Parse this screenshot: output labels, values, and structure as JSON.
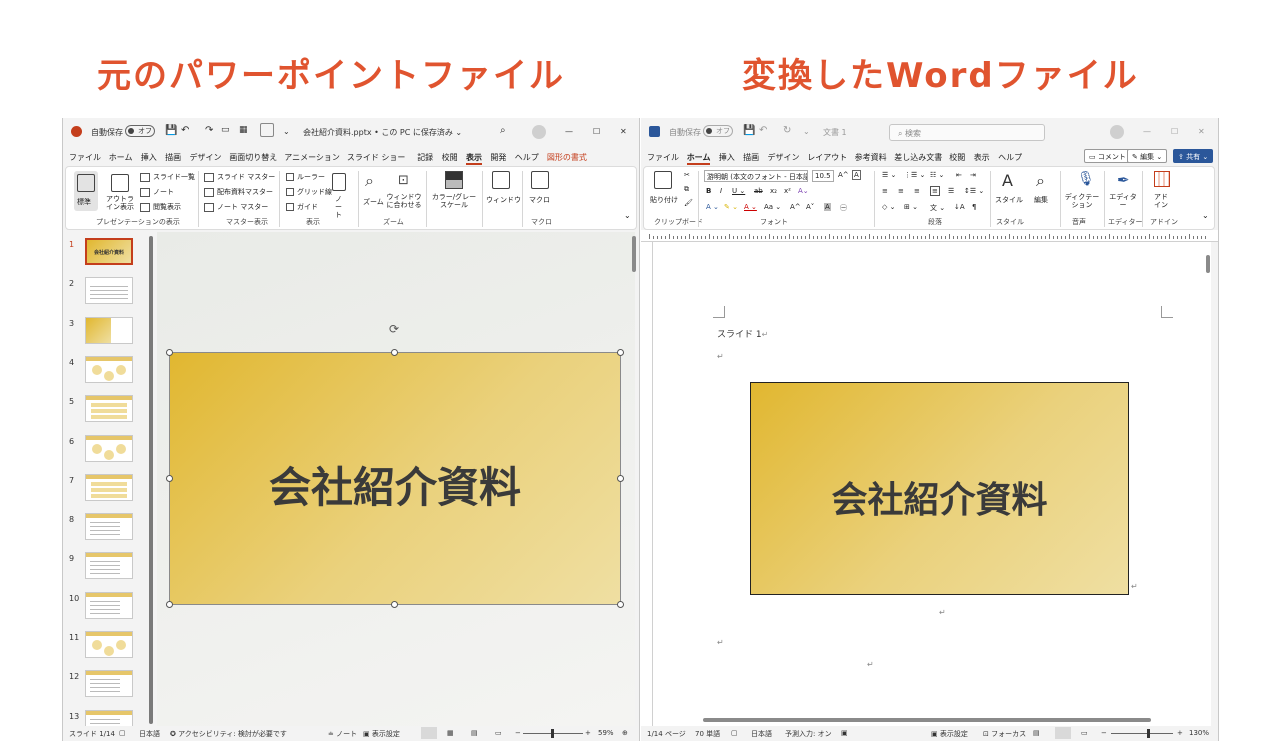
{
  "headings": {
    "left": "元のパワーポイントファイル",
    "right": "変換したWordファイル"
  },
  "colors": {
    "heading": "#e0542f",
    "ppt_accent": "#c43e1c",
    "word_accent": "#2b579a",
    "slide_gold": "#e1b730"
  },
  "ppt": {
    "autosave_label": "自動保存",
    "autosave_state": "オフ",
    "window_title": "会社紹介資料.pptx • この PC に保存済み ⌄",
    "menu": [
      "ファイル",
      "ホーム",
      "挿入",
      "描画",
      "デザイン",
      "画面切り替え",
      "アニメーション",
      "スライド ショー",
      "記録",
      "校閲",
      "表示",
      "開発",
      "ヘルプ",
      "図形の書式"
    ],
    "active_menu": "表示",
    "ribbon": {
      "normal": "標準",
      "outline": "アウトライン表示",
      "slide_sorter": "スライド一覧",
      "notes_page": "ノート",
      "reading": "閲覧表示",
      "group_presentation": "プレゼンテーションの表示",
      "slide_master": "スライド マスター",
      "handout_master": "配布資料マスター",
      "notes_master": "ノート マスター",
      "group_master": "マスター表示",
      "ruler": "ルーラー",
      "gridlines": "グリッド線",
      "guides": "ガイド",
      "notes": "ノート",
      "group_show": "表示",
      "zoom": "ズーム",
      "fit_window": "ウィンドウに合わせる",
      "group_zoom": "ズーム",
      "color_gray": "カラー/グレースケール",
      "window": "ウィンドウ",
      "macro": "マクロ",
      "group_macro": "マクロ"
    },
    "slide_numbers": [
      "1",
      "2",
      "3",
      "4",
      "5",
      "6",
      "7",
      "8",
      "9",
      "10",
      "11",
      "12",
      "13"
    ],
    "thumb1_title": "会社紹介資料",
    "slide_title": "会社紹介資料",
    "status": {
      "slide": "スライド 1/14",
      "language": "日本語",
      "accessibility": "アクセシビリティ: 検討が必要です",
      "notes": "ノート",
      "display": "表示設定",
      "zoom": "59%"
    }
  },
  "word": {
    "autosave_label": "自動保存",
    "autosave_state": "オフ",
    "doc_title": "文書 1",
    "search_placeholder": "検索",
    "menu": [
      "ファイル",
      "ホーム",
      "挿入",
      "描画",
      "デザイン",
      "レイアウト",
      "参考資料",
      "差し込み文書",
      "校閲",
      "表示",
      "ヘルプ"
    ],
    "active_menu": "ホーム",
    "comment_btn": "コメント",
    "edit_btn": "編集",
    "share_btn": "共有",
    "ribbon": {
      "paste": "貼り付け",
      "group_clipboard": "クリップボード",
      "font_name": "游明朝 (本文のフォント - 日本語",
      "font_size": "10.5",
      "group_font": "フォント",
      "group_paragraph": "段落",
      "style": "スタイル",
      "group_style": "スタイル",
      "edit": "編集",
      "dictate": "ディクテーション",
      "group_voice": "音声",
      "editor": "エディター",
      "group_editor": "エディター",
      "addin": "アドイン",
      "group_addin": "アドイン"
    },
    "body_heading": "スライド 1",
    "slide_title": "会社紹介資料",
    "status": {
      "page": "1/14 ページ",
      "words": "70 単語",
      "language": "日本語",
      "prediction": "予測入力: オン",
      "display": "表示設定",
      "focus": "フォーカス",
      "zoom": "130%"
    }
  }
}
